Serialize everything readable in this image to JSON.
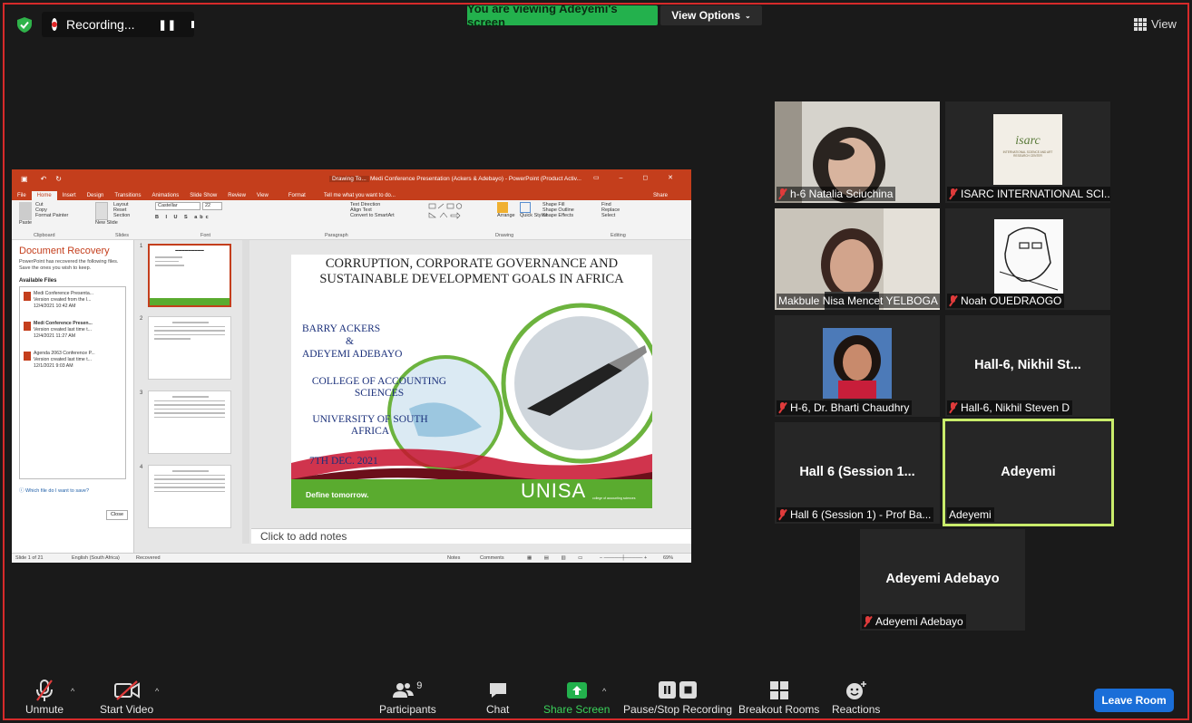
{
  "top_bar": {
    "recording_text": "Recording...",
    "viewing_banner": "You are viewing Adeyemi's screen",
    "view_options": "View Options",
    "view_label": "View"
  },
  "shared_screen": {
    "title_bar": "Medi Conference Presentation (Ackers & Adebayo) - PowerPoint (Product Activ...",
    "drawing_tools": "Drawing To...",
    "tabs": [
      "File",
      "Home",
      "Insert",
      "Design",
      "Transitions",
      "Animations",
      "Slide Show",
      "Review",
      "View",
      "Format"
    ],
    "tell_me": "Tell me what you want to do...",
    "share": "Share",
    "ribbon": {
      "cut": "Cut",
      "copy": "Copy",
      "paste": "Paste",
      "format_painter": "Format Painter",
      "clipboard": "Clipboard",
      "new_slide": "New Slide",
      "layout": "Layout",
      "reset": "Reset",
      "section": "Section",
      "slides": "Slides",
      "font_name": "Castellar",
      "font_size": "22",
      "font": "Font",
      "text_direction": "Text Direction",
      "align_text": "Align Text",
      "convert_smartart": "Convert to SmartArt",
      "paragraph": "Paragraph",
      "arrange": "Arrange",
      "quick_styles": "Quick Styles",
      "shape_fill": "Shape Fill",
      "shape_outline": "Shape Outline",
      "shape_effects": "Shape Effects",
      "drawing": "Drawing",
      "find": "Find",
      "replace": "Replace",
      "select": "Select",
      "editing": "Editing"
    },
    "recovery": {
      "title": "Document Recovery",
      "description": "PowerPoint has recovered the following files. Save the ones you wish to keep.",
      "available": "Available Files",
      "files": [
        {
          "name": "Medi Conference Presenta...",
          "line2": "Version created from the l...",
          "line3": "12/4/2021 10:42 AM"
        },
        {
          "name": "Medi Conference Presen...",
          "line2": "Version created last time t...",
          "line3": "12/4/2021 11:27 AM"
        },
        {
          "name": "Agenda 2063 Conference P...",
          "line2": "Version created last time t...",
          "line3": "12/1/2021 9:03 AM"
        }
      ],
      "help": "Which file do I want to save?",
      "close": "Close"
    },
    "thumb_numbers": [
      "1",
      "2",
      "3",
      "4"
    ],
    "slide": {
      "title": "CORRUPTION, CORPORATE GOVERNANCE AND SUSTAINABLE DEVELOPMENT GOALS IN AFRICA",
      "author1": "BARRY ACKERS",
      "amp": "&",
      "author2": "ADEYEMI ADEBAYO",
      "college": "COLLEGE OF ACCOUNTING SCIENCES",
      "university": "UNIVERSITY OF SOUTH AFRICA",
      "date": "7TH DEC. 2021",
      "define": "Define tomorrow.",
      "unisa": "UNISA",
      "unisa_sub": "college of accounting sciences"
    },
    "notes": "Click to add notes",
    "status": {
      "slide_of": "Slide 1 of 21",
      "language": "English (South Africa)",
      "recovered": "Recovered",
      "notes": "Notes",
      "comments": "Comments",
      "zoom": "69%"
    }
  },
  "participants_tiles": [
    {
      "label": "h-6 Natalia Sciuchina",
      "muted": true
    },
    {
      "label": "ISARC INTERNATIONAL SCI...",
      "muted": true,
      "logo_line1": "isarc",
      "logo_line2": "INTERNATIONAL SCIENCE AND ART RESEARCH CENTER"
    },
    {
      "label": "Makbule Nisa Mencet YELBOGA",
      "muted": false
    },
    {
      "label": "Noah OUEDRAOGO",
      "muted": true
    },
    {
      "label": "H-6, Dr. Bharti Chaudhry",
      "muted": true
    },
    {
      "label": "Hall-6,  Nikhil Steven D",
      "muted": true,
      "center": "Hall-6,  Nikhil St..."
    },
    {
      "label": "Hall 6 (Session 1) - Prof Ba...",
      "muted": true,
      "center": "Hall 6 (Session 1..."
    },
    {
      "label": "Adeyemi",
      "muted": false,
      "center": "Adeyemi"
    },
    {
      "label": "Adeyemi Adebayo",
      "muted": true,
      "center": "Adeyemi Adebayo"
    }
  ],
  "toolbar": {
    "unmute": "Unmute",
    "start_video": "Start Video",
    "participants": "Participants",
    "participants_count": "9",
    "chat": "Chat",
    "share_screen": "Share Screen",
    "pause_stop": "Pause/Stop Recording",
    "breakout": "Breakout Rooms",
    "reactions": "Reactions",
    "leave": "Leave Room"
  },
  "colors": {
    "accent_green": "#23b14d",
    "leave_blue": "#1a6ed8",
    "active_speaker": "#c9ec6b",
    "powerpoint": "#c43e1c"
  }
}
